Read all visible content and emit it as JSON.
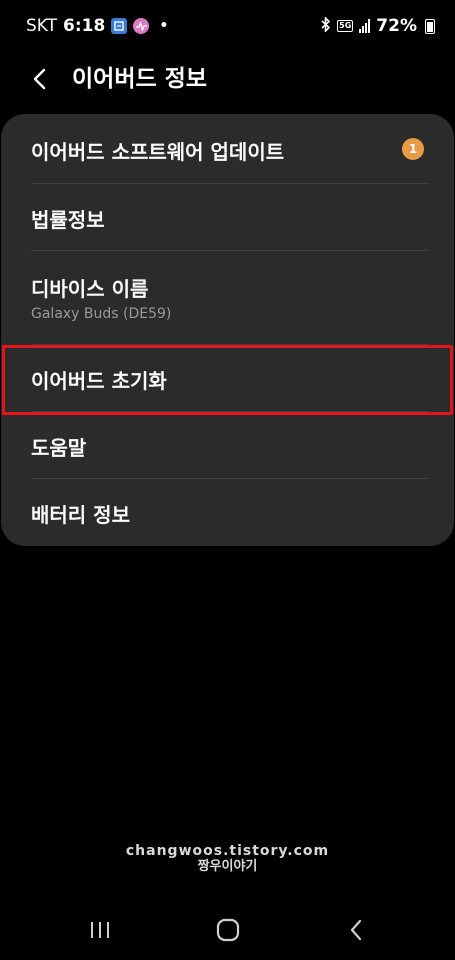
{
  "status_bar": {
    "carrier": "SKT",
    "time": "6:18",
    "battery": "72%",
    "network": "5G",
    "icons": [
      "notification-app-icon",
      "notification-health-icon",
      "more-notifications-dot",
      "bluetooth-icon",
      "5g-icon",
      "signal-icon",
      "battery-icon"
    ]
  },
  "app_bar": {
    "title": "이어버드 정보",
    "back_icon": "chevron-left-icon"
  },
  "menu": {
    "items": [
      {
        "label": "이어버드 소프트웨어 업데이트",
        "badge": "1"
      },
      {
        "label": "법률정보"
      },
      {
        "label": "디바이스 이름",
        "subtitle": "Galaxy Buds (DE59)"
      },
      {
        "label": "이어버드 초기화"
      },
      {
        "label": "도움말"
      },
      {
        "label": "배터리 정보"
      }
    ]
  },
  "watermark": {
    "url": "changwoos.tistory.com",
    "name": "짱우이야기"
  },
  "nav_bar": {
    "icons": [
      "recents-icon",
      "home-icon",
      "back-icon"
    ]
  },
  "colors": {
    "background": "#000000",
    "card": "#2b2b2b",
    "badge": "#e89b47",
    "highlight": "#e5141b",
    "subtitle": "#9a9a9a"
  }
}
